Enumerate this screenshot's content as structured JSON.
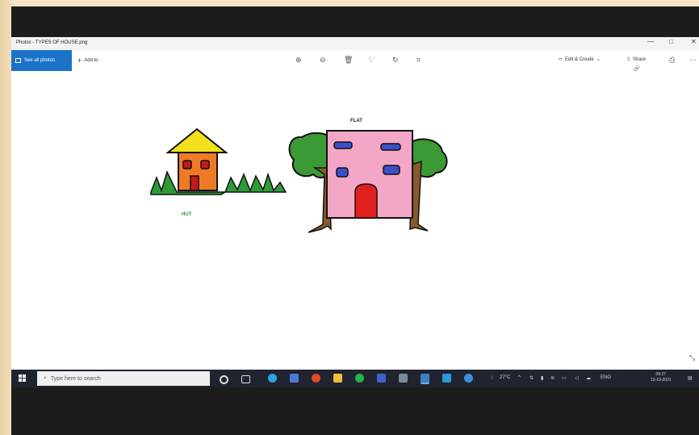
{
  "window": {
    "title": "Photos - TYPES OF HOUSE.png",
    "min_glyph": "—",
    "max_glyph": "□",
    "close_glyph": "✕"
  },
  "toolbar": {
    "see_all": "See all photos",
    "add_to": "Add to",
    "edit_create": "Edit & Create",
    "share": "Share",
    "more": "···"
  },
  "image": {
    "hut_label": "HUT",
    "flat_label": "FLAT"
  },
  "taskbar": {
    "search_placeholder": "Type here to search",
    "temperature": "27°C",
    "language": "ENG",
    "time": "09:27",
    "date": "12-10-2021"
  },
  "colors": {
    "accent": "#1a73c8",
    "taskbar": "#1f2430",
    "grass": "#2e9b36",
    "hut_roof": "#f2e01c",
    "hut_wall": "#f07a24",
    "flat_wall": "#f4a6c6",
    "window_blue": "#3b4fc9",
    "door_red": "#e0201c",
    "trunk": "#8b5a2b",
    "foliage": "#3a9a35"
  }
}
